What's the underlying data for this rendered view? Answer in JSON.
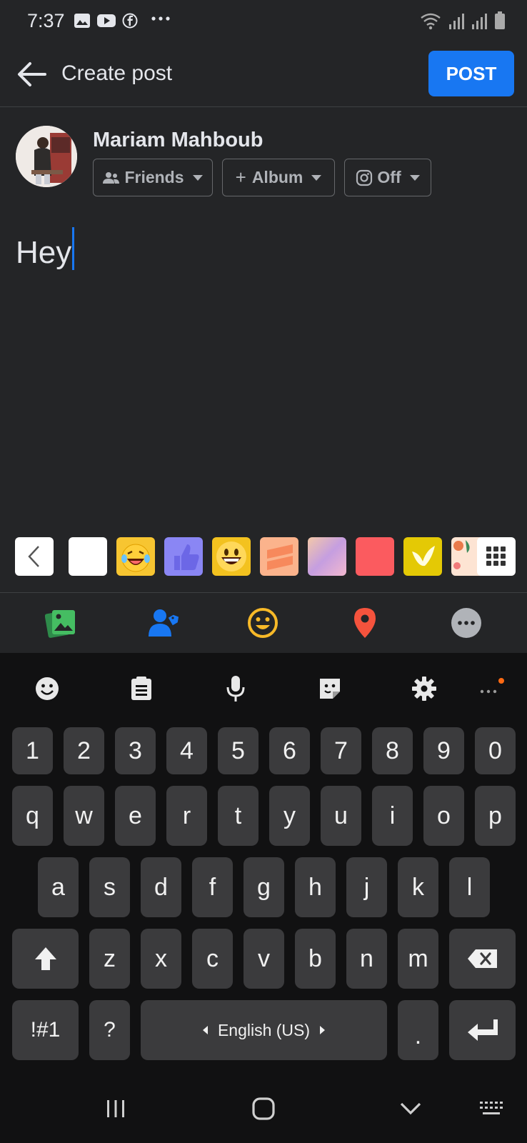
{
  "status_bar": {
    "time": "7:37",
    "icons_left": [
      "gallery-icon",
      "youtube-icon",
      "facebook-icon",
      "more-dots-icon"
    ],
    "icons_right": [
      "wifi-icon",
      "signal-icon",
      "signal-icon",
      "battery-icon"
    ]
  },
  "header": {
    "title": "Create post",
    "post_label": "POST"
  },
  "user": {
    "name": "Mariam Mahboub"
  },
  "chips": {
    "audience": "Friends",
    "album": "Album",
    "instagram": "Off"
  },
  "composer": {
    "text": "Hey"
  },
  "backgrounds": {
    "colors": [
      "#ffffff",
      "#f7c531",
      "#8a86f4",
      "#f3c21f",
      "#fbb38c",
      "#d7a7df",
      "#fb5b5f",
      "#e4c905",
      "#fde4d3"
    ]
  },
  "actions": [
    "photo-icon",
    "tag-people-icon",
    "feeling-icon",
    "location-icon",
    "more-icon"
  ],
  "keyboard": {
    "row_numbers": [
      "1",
      "2",
      "3",
      "4",
      "5",
      "6",
      "7",
      "8",
      "9",
      "0"
    ],
    "row_q": [
      "q",
      "w",
      "e",
      "r",
      "t",
      "y",
      "u",
      "i",
      "o",
      "p"
    ],
    "row_a": [
      "a",
      "s",
      "d",
      "f",
      "g",
      "h",
      "j",
      "k",
      "l"
    ],
    "row_z": [
      "z",
      "x",
      "c",
      "v",
      "b",
      "n",
      "m"
    ],
    "symbols_label": "!#1",
    "question_label": "?",
    "space_label": "English (US)",
    "period_label": "."
  },
  "colors": {
    "accent": "#1877f2",
    "background": "#242527",
    "keyboard_bg": "#111112",
    "key_bg": "#3b3b3d"
  }
}
